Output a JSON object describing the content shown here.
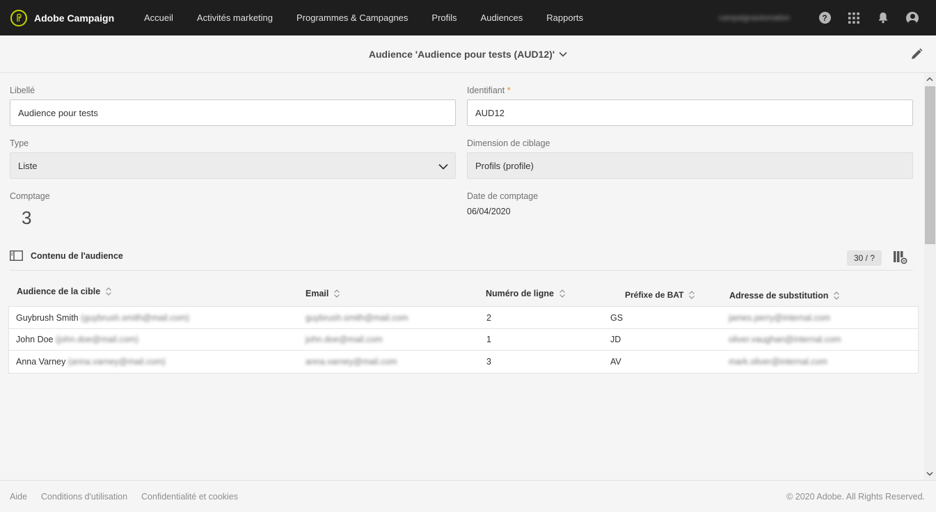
{
  "app": {
    "name": "Adobe Campaign",
    "logo_icon": "adobe-campaign-logo-icon",
    "accent_color": "#c8d400"
  },
  "nav": {
    "items": [
      {
        "label": "Accueil"
      },
      {
        "label": "Activités marketing"
      },
      {
        "label": "Programmes & Campagnes"
      },
      {
        "label": "Profils"
      },
      {
        "label": "Audiences"
      },
      {
        "label": "Rapports"
      }
    ]
  },
  "topbar": {
    "user": "campaignautomation",
    "help_glyph": "?",
    "icons": [
      "help-icon",
      "apps-grid-icon",
      "bell-icon",
      "user-avatar-icon"
    ]
  },
  "header": {
    "title": "Audience 'Audience pour tests (AUD12)'",
    "edit_icon": "pencil-icon"
  },
  "form": {
    "libelle": {
      "label": "Libellé",
      "value": "Audience pour tests"
    },
    "identifiant": {
      "label": "Identifiant",
      "required_mark": "*",
      "value": "AUD12"
    },
    "type": {
      "label": "Type",
      "value": "Liste"
    },
    "dimension": {
      "label": "Dimension de ciblage",
      "value": "Profils (profile)"
    },
    "comptage": {
      "label": "Comptage",
      "value": "3"
    },
    "date_comptage": {
      "label": "Date de comptage",
      "value": "06/04/2020"
    }
  },
  "content": {
    "title": "Contenu de l'audience",
    "pager": "30 / ?",
    "columns": [
      {
        "label": "Audience de la cible"
      },
      {
        "label": "Email"
      },
      {
        "label": "Numéro de ligne"
      },
      {
        "label": "Préfixe de BAT"
      },
      {
        "label": "Adresse de substitution"
      }
    ],
    "rows": [
      {
        "name": "Guybrush Smith",
        "name_email": "(guybrush.smith@mail.com)",
        "email": "guybrush.smith@mail.com",
        "line": "2",
        "prefix": "GS",
        "substitution": "james.perry@internal.com"
      },
      {
        "name": "John Doe",
        "name_email": "(john.doe@mail.com)",
        "email": "john.doe@mail.com",
        "line": "1",
        "prefix": "JD",
        "substitution": "oliver.vaughan@internal.com"
      },
      {
        "name": "Anna Varney",
        "name_email": "(anna.varney@mail.com)",
        "email": "anna.varney@mail.com",
        "line": "3",
        "prefix": "AV",
        "substitution": "mark.oliver@internal.com"
      }
    ]
  },
  "footer": {
    "links": [
      {
        "label": "Aide"
      },
      {
        "label": "Conditions d'utilisation"
      },
      {
        "label": "Confidentialité et cookies"
      }
    ],
    "copyright": "© 2020 Adobe. All Rights Reserved."
  }
}
